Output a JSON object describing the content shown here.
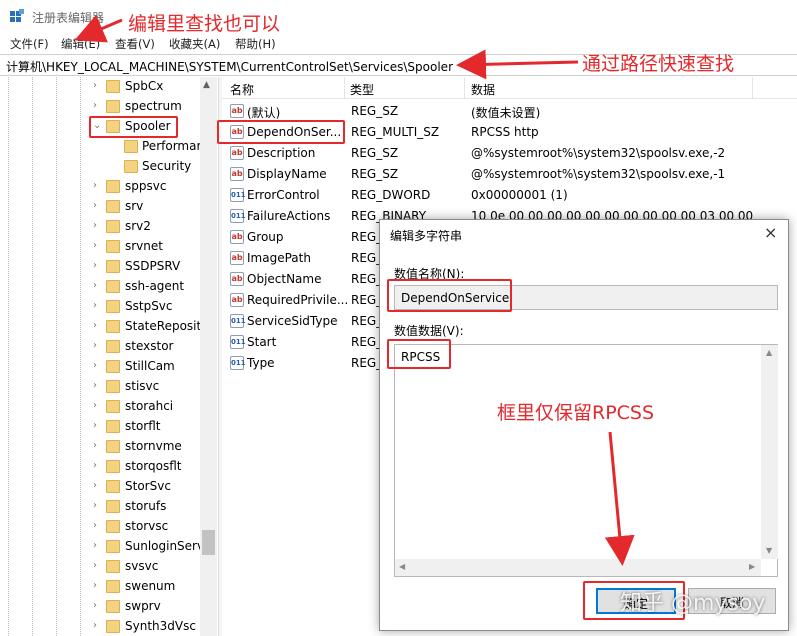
{
  "window": {
    "title": "注册表编辑器"
  },
  "menu": [
    "文件(F)",
    "编辑(E)",
    "查看(V)",
    "收藏夹(A)",
    "帮助(H)"
  ],
  "address": {
    "path": "计算机\\HKEY_LOCAL_MACHINE\\SYSTEM\\CurrentControlSet\\Services\\Spooler"
  },
  "tree": {
    "items": [
      "SpbCx",
      "spectrum",
      "Spooler",
      "Performar",
      "Security",
      "sppsvc",
      "srv",
      "srv2",
      "srvnet",
      "SSDPSRV",
      "ssh-agent",
      "SstpSvc",
      "StateReposit",
      "stexstor",
      "StillCam",
      "stisvc",
      "storahci",
      "storflt",
      "stornvme",
      "storqosflt",
      "StorSvc",
      "storufs",
      "storvsc",
      "SunloginServ",
      "svsvc",
      "swenum",
      "swprv",
      "Synth3dVsc"
    ]
  },
  "list": {
    "headers": [
      "名称",
      "类型",
      "数据"
    ],
    "rows": [
      {
        "name": "(默认)",
        "type": "REG_SZ",
        "data": "(数值未设置)",
        "icon": "string-value-icon"
      },
      {
        "name": "DependOnSer...",
        "type": "REG_MULTI_SZ",
        "data": "RPCSS http",
        "icon": "string-value-icon"
      },
      {
        "name": "Description",
        "type": "REG_SZ",
        "data": "@%systemroot%\\system32\\spoolsv.exe,-2",
        "icon": "string-value-icon"
      },
      {
        "name": "DisplayName",
        "type": "REG_SZ",
        "data": "@%systemroot%\\system32\\spoolsv.exe,-1",
        "icon": "string-value-icon"
      },
      {
        "name": "ErrorControl",
        "type": "REG_DWORD",
        "data": "0x00000001 (1)",
        "icon": "binary-value-icon"
      },
      {
        "name": "FailureActions",
        "type": "REG_BINARY",
        "data": "10 0e 00 00 00 00 00 00 00 00 00 00 03 00 00",
        "icon": "binary-value-icon"
      },
      {
        "name": "Group",
        "type": "REG_",
        "data": "",
        "icon": "string-value-icon"
      },
      {
        "name": "ImagePath",
        "type": "REG_",
        "data": "",
        "icon": "string-value-icon"
      },
      {
        "name": "ObjectName",
        "type": "REG_",
        "data": "",
        "icon": "string-value-icon"
      },
      {
        "name": "RequiredPrivile...",
        "type": "REG_",
        "data": "",
        "icon": "string-value-icon"
      },
      {
        "name": "ServiceSidType",
        "type": "REG_",
        "data": "",
        "icon": "binary-value-icon"
      },
      {
        "name": "Start",
        "type": "REG_",
        "data": "",
        "icon": "binary-value-icon"
      },
      {
        "name": "Type",
        "type": "REG_",
        "data": "",
        "icon": "binary-value-icon"
      }
    ]
  },
  "dialog": {
    "title": "编辑多字符串",
    "close": "×",
    "name_label": "数值名称(N):",
    "name_value": "DependOnService",
    "data_label": "数值数据(V):",
    "data_value": "RPCSS",
    "ok_label": "确定",
    "cancel_label": "取消"
  },
  "annotations": {
    "edit_menu": "编辑里查找也可以",
    "path": "通过路径快速查找",
    "keep": "框里仅保留RPCSS"
  },
  "watermark": "知乎 @mysoy",
  "colors": {
    "annotation_red": "#e4292d",
    "folder": "#f3d382",
    "selection_blue": "#0078d7"
  }
}
